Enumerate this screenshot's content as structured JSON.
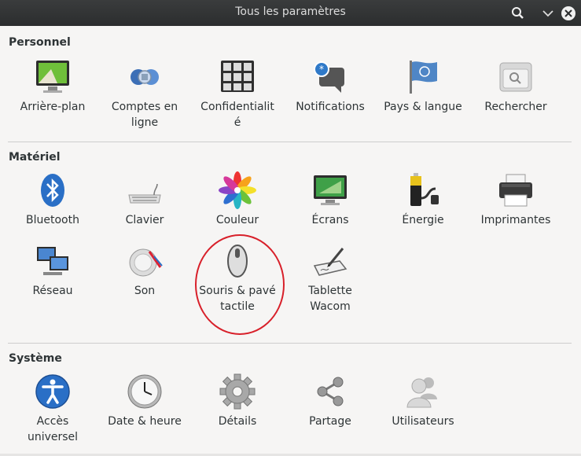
{
  "window": {
    "title": "Tous les paramètres",
    "buttons": [
      "search-icon",
      "chevron-down-icon",
      "close-icon"
    ]
  },
  "sections": [
    {
      "title": "Personnel",
      "items": [
        {
          "label": "Arrière-plan",
          "icon": "background-icon"
        },
        {
          "label": "Comptes en ligne",
          "icon": "online-accounts-icon"
        },
        {
          "label": "Confidentialité",
          "icon": "privacy-icon"
        },
        {
          "label": "Notifications",
          "icon": "notifications-icon"
        },
        {
          "label": "Pays & langue",
          "icon": "region-language-icon"
        },
        {
          "label": "Rechercher",
          "icon": "search-settings-icon"
        }
      ]
    },
    {
      "title": "Matériel",
      "items": [
        {
          "label": "Bluetooth",
          "icon": "bluetooth-icon"
        },
        {
          "label": "Clavier",
          "icon": "keyboard-icon"
        },
        {
          "label": "Couleur",
          "icon": "color-icon"
        },
        {
          "label": "Écrans",
          "icon": "displays-icon"
        },
        {
          "label": "Énergie",
          "icon": "power-icon"
        },
        {
          "label": "Imprimantes",
          "icon": "printer-icon"
        },
        {
          "label": "Réseau",
          "icon": "network-icon"
        },
        {
          "label": "Son",
          "icon": "sound-icon"
        },
        {
          "label": "Souris & pavé tactile",
          "icon": "mouse-icon"
        },
        {
          "label": "Tablette Wacom",
          "icon": "wacom-tablet-icon"
        }
      ]
    },
    {
      "title": "Système",
      "items": [
        {
          "label": "Accès universel",
          "icon": "universal-access-icon"
        },
        {
          "label": "Date & heure",
          "icon": "clock-icon"
        },
        {
          "label": "Détails",
          "icon": "details-gear-icon"
        },
        {
          "label": "Partage",
          "icon": "sharing-icon"
        },
        {
          "label": "Utilisateurs",
          "icon": "users-icon"
        }
      ]
    }
  ],
  "colors": {
    "titlebar": "#2b2d2e",
    "background": "#f6f5f4",
    "highlight_circle": "#d8202a"
  }
}
